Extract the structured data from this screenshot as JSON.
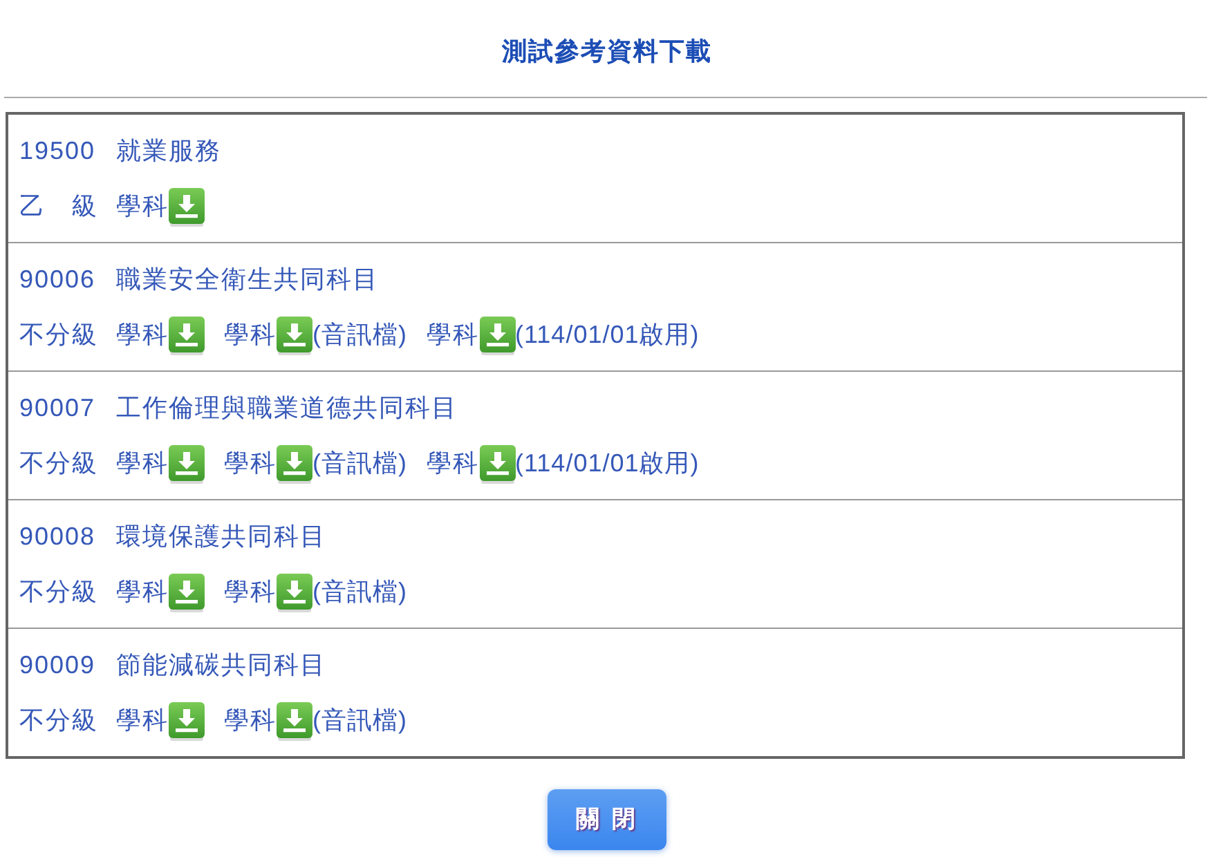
{
  "title": "測試參考資料下載",
  "subjects": [
    {
      "code": "19500",
      "name": "就業服務",
      "level": "乙　級",
      "files": [
        {
          "label": "學科"
        }
      ]
    },
    {
      "code": "90006",
      "name": "職業安全衛生共同科目",
      "level": "不分級",
      "files": [
        {
          "label": "學科"
        },
        {
          "label": "學科",
          "note": "(音訊檔)"
        },
        {
          "label": "學科",
          "note": "(114/01/01啟用)"
        }
      ]
    },
    {
      "code": "90007",
      "name": "工作倫理與職業道德共同科目",
      "level": "不分級",
      "files": [
        {
          "label": "學科"
        },
        {
          "label": "學科",
          "note": "(音訊檔)"
        },
        {
          "label": "學科",
          "note": "(114/01/01啟用)"
        }
      ]
    },
    {
      "code": "90008",
      "name": "環境保護共同科目",
      "level": "不分級",
      "files": [
        {
          "label": "學科"
        },
        {
          "label": "學科",
          "note": "(音訊檔)"
        }
      ]
    },
    {
      "code": "90009",
      "name": "節能減碳共同科目",
      "level": "不分級",
      "files": [
        {
          "label": "學科"
        },
        {
          "label": "學科",
          "note": "(音訊檔)"
        }
      ]
    }
  ],
  "close_button": "關 閉"
}
